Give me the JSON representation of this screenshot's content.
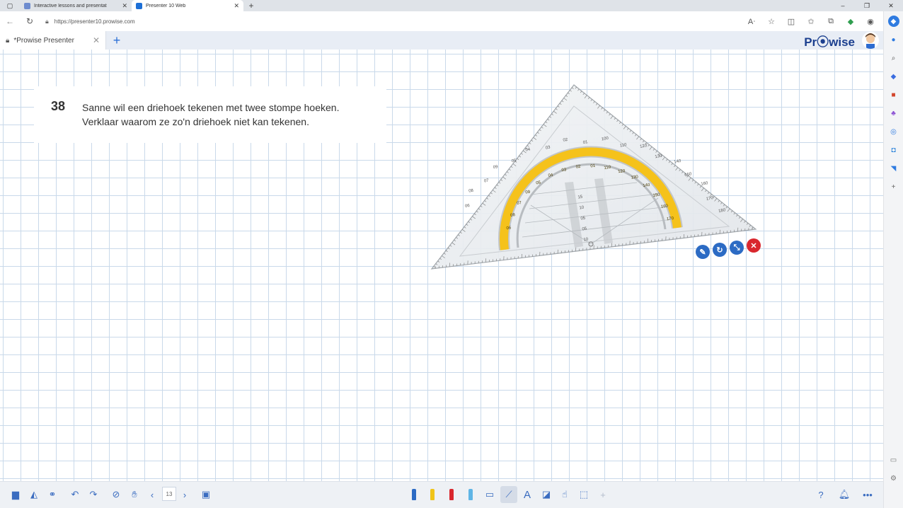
{
  "browser": {
    "tabs": [
      {
        "title": "Interactive lessons and presentat",
        "active": false
      },
      {
        "title": "Presenter 10 Web",
        "active": true
      }
    ],
    "url": "https://presenter10.prowise.com"
  },
  "app": {
    "doc_tab_title": "*Prowise Presenter",
    "brand": "Pr⦿wise"
  },
  "question": {
    "number": "38",
    "line1": "Sanne wil een driehoek tekenen met twee stompe hoeken.",
    "line2": "Verklaar waarom ze zo'n driehoek niet kan tekenen."
  },
  "geodriehoek": {
    "outer_labels": [
      "06",
      "08",
      "07",
      "09",
      "05",
      "04",
      "03",
      "02",
      "01",
      "100",
      "110",
      "120",
      "130",
      "140",
      "150",
      "160",
      "170",
      "180"
    ],
    "protractor_labels": [
      "06",
      "08",
      "07",
      "09",
      "05",
      "04",
      "03",
      "02",
      "01",
      "110",
      "120",
      "130",
      "140",
      "150",
      "160",
      "170"
    ],
    "center_labels": [
      "15",
      "10",
      "05",
      "05",
      "10"
    ]
  },
  "toolbar": {
    "page_number": "13"
  },
  "colors": {
    "accent": "#2c6bc4",
    "brand": "#1b3f8f",
    "protractor_yellow": "#f5c21b",
    "close_red": "#d9272e",
    "grid": "#c9d9ea"
  }
}
